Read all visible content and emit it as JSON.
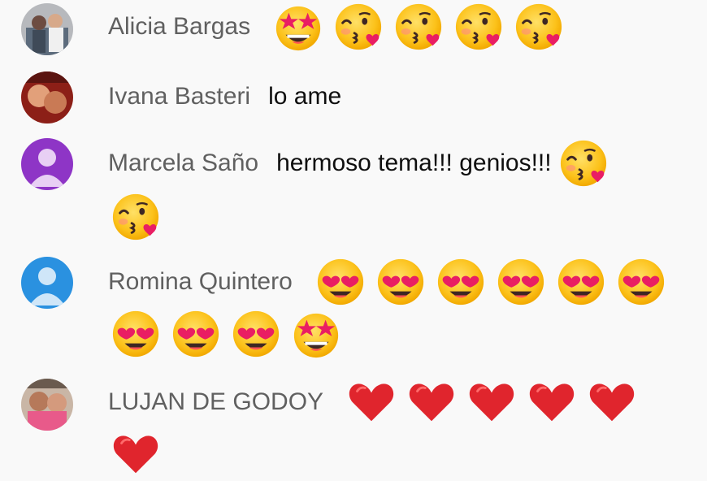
{
  "chat": {
    "messages": [
      {
        "author": "Alicia Bargas",
        "text": "",
        "avatar": "avatar-photo-icon",
        "emojis": [
          "star-struck-emoji-icon",
          "kissing-heart-emoji-icon",
          "kissing-heart-emoji-icon",
          "kissing-heart-emoji-icon",
          "kissing-heart-emoji-icon"
        ]
      },
      {
        "author": "Ivana Basteri",
        "text": "lo ame",
        "avatar": "avatar-photo-icon",
        "emojis": []
      },
      {
        "author": "Marcela Saño",
        "text": "hermoso tema!!! genios!!!",
        "avatar": "default-avatar-purple-icon",
        "emojis": [
          "kissing-heart-emoji-icon",
          "kissing-heart-emoji-icon"
        ]
      },
      {
        "author": "Romina Quintero",
        "text": "",
        "avatar": "default-avatar-blue-icon",
        "emojis": [
          "heart-eyes-emoji-icon",
          "heart-eyes-emoji-icon",
          "heart-eyes-emoji-icon",
          "heart-eyes-emoji-icon",
          "heart-eyes-emoji-icon",
          "heart-eyes-emoji-icon",
          "heart-eyes-emoji-icon",
          "heart-eyes-emoji-icon",
          "heart-eyes-emoji-icon",
          "star-struck-emoji-icon"
        ]
      },
      {
        "author": "LUJAN DE GODOY",
        "text": "",
        "avatar": "avatar-photo-icon",
        "emojis": [
          "red-heart-icon",
          "red-heart-icon",
          "red-heart-icon",
          "red-heart-icon",
          "red-heart-icon",
          "red-heart-icon"
        ]
      }
    ]
  },
  "colors": {
    "author": "#606060",
    "message": "#0f0f0f",
    "background": "#f9f9f9",
    "default_avatar_purple": "#8e35c6",
    "default_avatar_blue": "#2a91e0"
  }
}
